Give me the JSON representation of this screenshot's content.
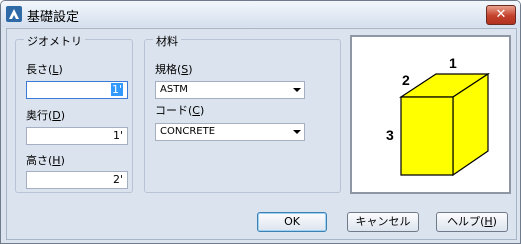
{
  "window": {
    "title": "基礎設定"
  },
  "geometry": {
    "group_label": "ジオメトリ",
    "length": {
      "label": "長さ",
      "hotkey": "L",
      "value": "1'"
    },
    "depth": {
      "label": "奥行",
      "hotkey": "D",
      "value": "1'"
    },
    "height": {
      "label": "高さ",
      "hotkey": "H",
      "value": "2'"
    }
  },
  "material": {
    "group_label": "材料",
    "standard": {
      "label": "規格",
      "hotkey": "S",
      "value": "ASTM"
    },
    "code": {
      "label": "コード",
      "hotkey": "C",
      "value": "CONCRETE"
    }
  },
  "preview": {
    "labels": {
      "one": "1",
      "two": "2",
      "three": "3"
    },
    "cube_color": "#ffff00"
  },
  "buttons": {
    "ok": "OK",
    "cancel": "キャンセル",
    "help": "ヘルプ",
    "help_hotkey": "H"
  },
  "colors": {
    "accent": "#3399ff",
    "close": "#c4412c"
  }
}
